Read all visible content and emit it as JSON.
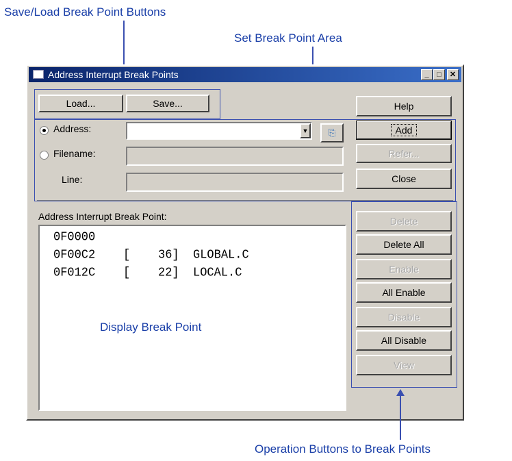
{
  "annotations": {
    "save_load": "Save/Load Break Point Buttons",
    "set_area": "Set Break Point Area",
    "display": "Display Break Point",
    "operations": "Operation Buttons to Break Points"
  },
  "window": {
    "title": "Address Interrupt Break Points",
    "minimize": "_",
    "maximize": "□",
    "close": "✕"
  },
  "buttons": {
    "load": "Load...",
    "save": "Save...",
    "help": "Help",
    "add": "Add",
    "refer": "Refer...",
    "close": "Close",
    "delete": "Delete",
    "delete_all": "Delete All",
    "enable": "Enable",
    "all_enable": "All Enable",
    "disable": "Disable",
    "all_disable": "All Disable",
    "view": "View"
  },
  "form": {
    "address_label": "Address:",
    "filename_label": "Filename:",
    "line_label": "Line:",
    "address_value": "",
    "filename_value": "",
    "line_value": "",
    "selected_option": "Address"
  },
  "list": {
    "heading": "Address Interrupt Break Point:",
    "rows": [
      "0F0000",
      "0F00C2    [    36]  GLOBAL.C",
      "0F012C    [    22]  LOCAL.C"
    ]
  },
  "colors": {
    "annotation_blue": "#1a3fa8",
    "title_bar": "#0a246a",
    "window_face": "#d4d0c8"
  }
}
